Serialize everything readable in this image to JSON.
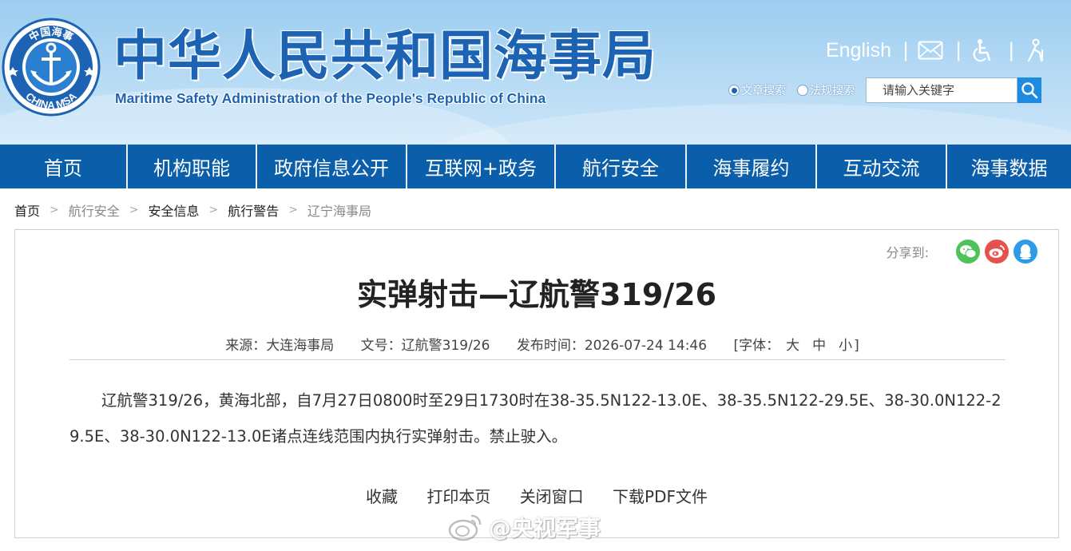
{
  "header": {
    "title_cn": "中华人民共和国海事局",
    "title_en": "Maritime Safety Administration of the People's Republic of China",
    "logo_text": "CHINA MSA",
    "logo_top_text": "中国海事",
    "english_link": "English",
    "separator": "|",
    "icons": [
      "mail-icon",
      "accessibility-icon",
      "elder-care-icon"
    ],
    "search": {
      "options": [
        {
          "label": "文章搜索",
          "selected": true
        },
        {
          "label": "法规搜索",
          "selected": false
        }
      ],
      "placeholder": "请输入关键字"
    }
  },
  "nav": {
    "items": [
      "首页",
      "机构职能",
      "政府信息公开",
      "互联网+政务",
      "航行安全",
      "海事履约",
      "互动交流",
      "海事数据"
    ]
  },
  "breadcrumb": {
    "items": [
      "首页",
      "航行安全",
      "安全信息",
      "航行警告",
      "辽宁海事局"
    ],
    "arrow": ">"
  },
  "article": {
    "share_label": "分享到:",
    "title": "实弹射击—辽航警319/26",
    "meta": {
      "source": "来源：大连海事局",
      "doc_no": "文号：辽航警319/26",
      "published": "发布时间：2026-07-24 14:46",
      "font_size_label": "[字体：",
      "font_sizes": [
        "大",
        "中",
        "小"
      ],
      "font_size_close": "]"
    },
    "body": "辽航警319/26，黄海北部，自7月27日0800时至29日1730时在38-35.5N122-13.0E、38-35.5N122-29.5E、38-30.0N122-29.5E、38-30.0N122-13.0E诸点连线范围内执行实弹射击。禁止驶入。",
    "actions": [
      "收藏",
      "打印本页",
      "关闭窗口",
      "下载PDF文件"
    ]
  },
  "watermark": {
    "text": "@央视军事"
  },
  "colors": {
    "brand_blue": "#1d63b4",
    "nav_blue": "#0b5ea9",
    "wechat_green": "#4fc25a",
    "weibo_red": "#e6504d",
    "qq_blue": "#2e9be8"
  }
}
